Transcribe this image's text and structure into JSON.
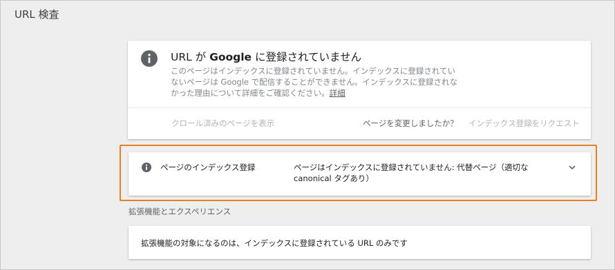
{
  "page": {
    "title": "URL 検査"
  },
  "status_card": {
    "title_prefix": "URL が ",
    "title_brand": "Google",
    "title_suffix": " に登録されていません",
    "description_lines": [
      "このページはインデックスに登録されていません。インデックスに登録されてい",
      "ないページは Google で配信することができません。インデックスに登録されな",
      "かった理由について詳細をご確認ください。"
    ],
    "learn_more": "詳細",
    "view_crawled": "クロール済みのページを表示",
    "page_changed": "ページを変更しましたか？",
    "request_indexing": "インデックス登録をリクエスト"
  },
  "index_card": {
    "label": "ページのインデックス登録",
    "value_lines": [
      "ページはインデックスに登録されていません: 代替ページ（適切な",
      "canonical タグあり）"
    ],
    "highlight_color": "#ef7d1a"
  },
  "enhancements": {
    "section_label": "拡張機能とエクスペリエンス",
    "message": "拡張機能の対象になるのは、インデックスに登録されている URL のみです"
  },
  "icons": {
    "info": "info-icon",
    "expand": "chevron-down-icon"
  },
  "colors": {
    "icon": "#5f6368",
    "disabled": "#b0b3b8"
  }
}
